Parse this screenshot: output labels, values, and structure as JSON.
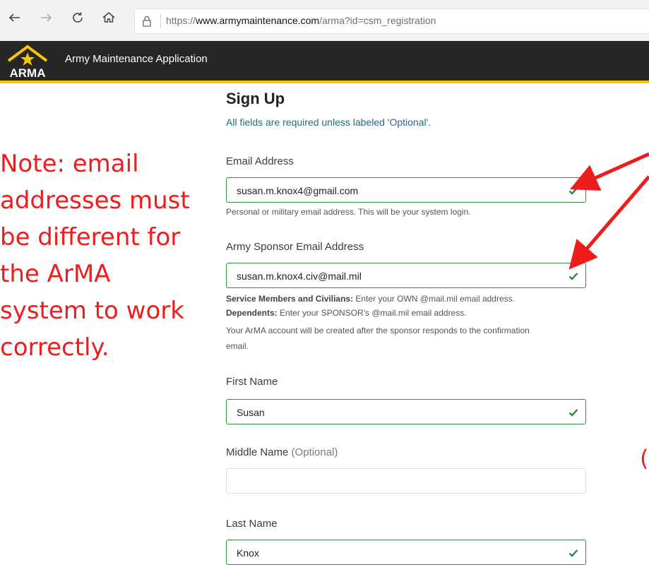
{
  "browser": {
    "url_prefix": "https://",
    "url_domain": "www.armymaintenance.com",
    "url_path": "/arma?id=csm_registration",
    "icons": [
      "back-arrow-icon",
      "forward-arrow-icon",
      "refresh-icon",
      "home-icon",
      "lock-icon"
    ]
  },
  "app": {
    "logo_text": "ARMA",
    "title": "Army Maintenance Application"
  },
  "form": {
    "heading": "Sign Up",
    "required_note": "All fields are required unless labeled 'Optional'.",
    "email": {
      "label": "Email Address",
      "value": "susan.m.knox4@gmail.com",
      "help": "Personal or military email address. This will be your system login."
    },
    "sponsor_email": {
      "label": "Army Sponsor Email Address",
      "value": "susan.m.knox4.civ@mail.mil",
      "help1_bold": "Service Members and Civilians:",
      "help1_text": " Enter your OWN @mail.mil email address.",
      "help2_bold": "Dependents:",
      "help2_text": " Enter your SPONSOR's @mail.mil email address.",
      "help3": "Your ArMA account will be created after the sponsor responds to the confirmation",
      "help4": "email."
    },
    "first_name": {
      "label": "First Name",
      "value": "Susan"
    },
    "middle_name": {
      "label": "Middle Name",
      "optional": "(Optional)",
      "value": ""
    },
    "last_name": {
      "label": "Last Name",
      "value": "Knox"
    }
  },
  "annotation": {
    "lines": [
      "Note: email",
      "addresses must",
      "be different for",
      "the ArMA",
      "system to work",
      "correctly."
    ],
    "edge_glyph": "(",
    "color": "#ef1c1c"
  },
  "colors": {
    "valid_border": "#2e8b3c",
    "header_bg": "#262626",
    "header_accent": "#f5c700",
    "required_note": "#1c6c8a"
  }
}
